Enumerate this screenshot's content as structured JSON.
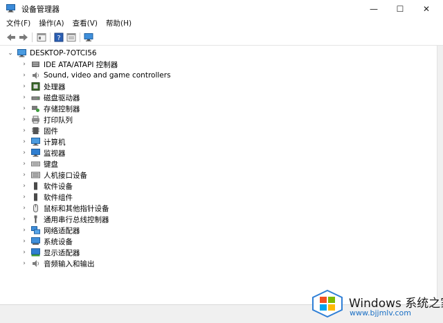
{
  "window": {
    "title": "设备管理器",
    "controls": {
      "minimize": "—",
      "maximize": "☐",
      "close": "✕"
    }
  },
  "menu": [
    "文件(F)",
    "操作(A)",
    "查看(V)",
    "帮助(H)"
  ],
  "toolbar": [
    "back-arrow-icon",
    "forward-arrow-icon",
    "properties-icon",
    "help-icon",
    "view-icon",
    "monitor-icon"
  ],
  "tree": {
    "root": "DESKTOP-7OTCI56",
    "categories": [
      {
        "label": "IDE ATA/ATAPI 控制器",
        "icon": "ide-controller-icon"
      },
      {
        "label": "Sound, video and game controllers",
        "icon": "speaker-icon"
      },
      {
        "label": "处理器",
        "icon": "processor-icon"
      },
      {
        "label": "磁盘驱动器",
        "icon": "disk-drive-icon"
      },
      {
        "label": "存储控制器",
        "icon": "storage-controller-icon"
      },
      {
        "label": "打印队列",
        "icon": "printer-icon"
      },
      {
        "label": "固件",
        "icon": "firmware-icon"
      },
      {
        "label": "计算机",
        "icon": "computer-icon"
      },
      {
        "label": "监视器",
        "icon": "monitor-icon"
      },
      {
        "label": "键盘",
        "icon": "keyboard-icon"
      },
      {
        "label": "人机接口设备",
        "icon": "hid-icon"
      },
      {
        "label": "软件设备",
        "icon": "software-device-icon"
      },
      {
        "label": "软件组件",
        "icon": "software-component-icon"
      },
      {
        "label": "鼠标和其他指针设备",
        "icon": "mouse-icon"
      },
      {
        "label": "通用串行总线控制器",
        "icon": "usb-icon"
      },
      {
        "label": "网络适配器",
        "icon": "network-adapter-icon"
      },
      {
        "label": "系统设备",
        "icon": "system-device-icon"
      },
      {
        "label": "显示适配器",
        "icon": "display-adapter-icon"
      },
      {
        "label": "音频输入和输出",
        "icon": "audio-io-icon"
      }
    ]
  },
  "watermark": {
    "brand": "Windows 系统之家",
    "url": "www.bjjmlv.com"
  },
  "colors": {
    "accent": "#3c7fc1",
    "text": "#000000",
    "chrome": "#ffffff"
  }
}
